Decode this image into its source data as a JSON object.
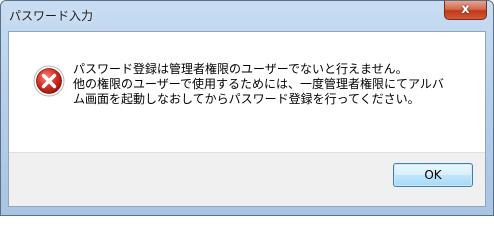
{
  "window": {
    "title": "パスワード入力",
    "close_glyph": "x"
  },
  "dialog": {
    "icon": "error-icon",
    "message_lines": [
      "パスワード登録は管理者権限のユーザーでないと行えません。",
      "他の権限のユーザーで使用するためには、一度管理者権限にてアルバ",
      "ム画面を起動しなおしてからパスワード登録を行ってください。"
    ],
    "ok_label": "OK"
  },
  "colors": {
    "error_red": "#d32f2f",
    "titlebar": "#b6cfea",
    "footer": "#f0f0f0"
  }
}
